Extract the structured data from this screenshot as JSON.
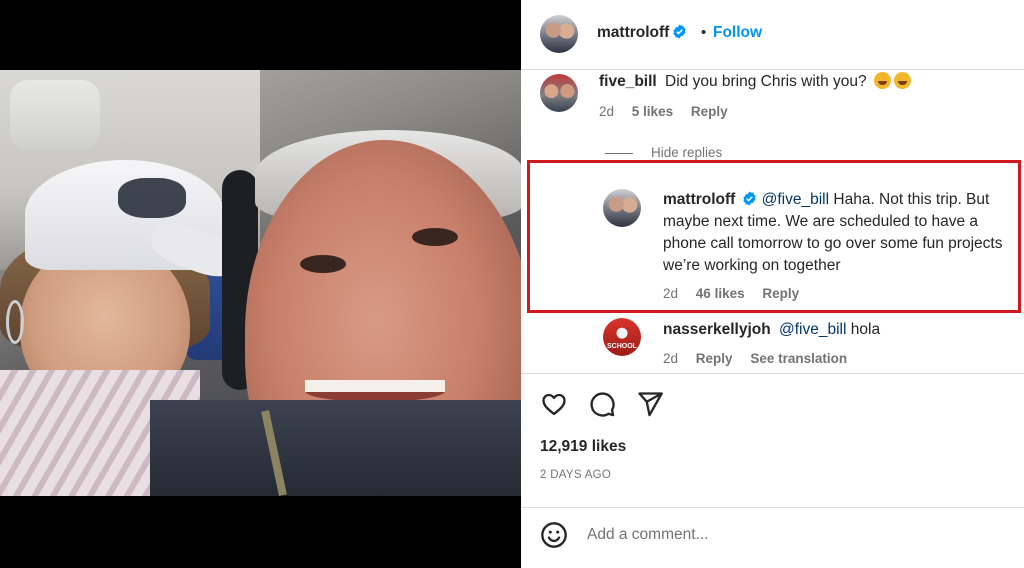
{
  "post": {
    "author": "mattroloff",
    "verified": true,
    "separator": "•",
    "follow_label": "Follow"
  },
  "comments": [
    {
      "username": "five_bill",
      "text": "Did you bring Chris with you?",
      "emojis": [
        "rolling-on-floor-laughing",
        "smiling-face"
      ],
      "time": "2d",
      "likes": "5 likes",
      "reply_label": "Reply"
    }
  ],
  "hide_replies_label": "Hide replies",
  "replies": [
    {
      "username": "mattroloff",
      "verified": true,
      "mention": "@five_bill",
      "text": "Haha. Not this trip. But maybe next time. We are scheduled to have a phone call tomorrow to go over some fun projects we’re working on together",
      "time": "2d",
      "likes": "46 likes",
      "reply_label": "Reply",
      "highlighted": true,
      "highlight_color": "#d0191f"
    },
    {
      "username": "nasserkellyjoh",
      "avatar_text": "SCHOOL",
      "mention": "@five_bill",
      "text": "hola",
      "time": "2d",
      "reply_label": "Reply",
      "translate_label": "See translation"
    }
  ],
  "actions": {
    "like_icon": "heart-icon",
    "comment_icon": "comment-bubble-icon",
    "share_icon": "paper-plane-icon"
  },
  "likes_count": "12,919 likes",
  "posted_date": "2 DAYS AGO",
  "add_comment": {
    "placeholder": "Add a comment...",
    "emoji_icon": "smiley-icon"
  },
  "colors": {
    "link_blue": "#0095f6",
    "mention_blue": "#00376b",
    "text": "#262626",
    "secondary_text": "#737373",
    "verified_badge": "#0095f6"
  }
}
